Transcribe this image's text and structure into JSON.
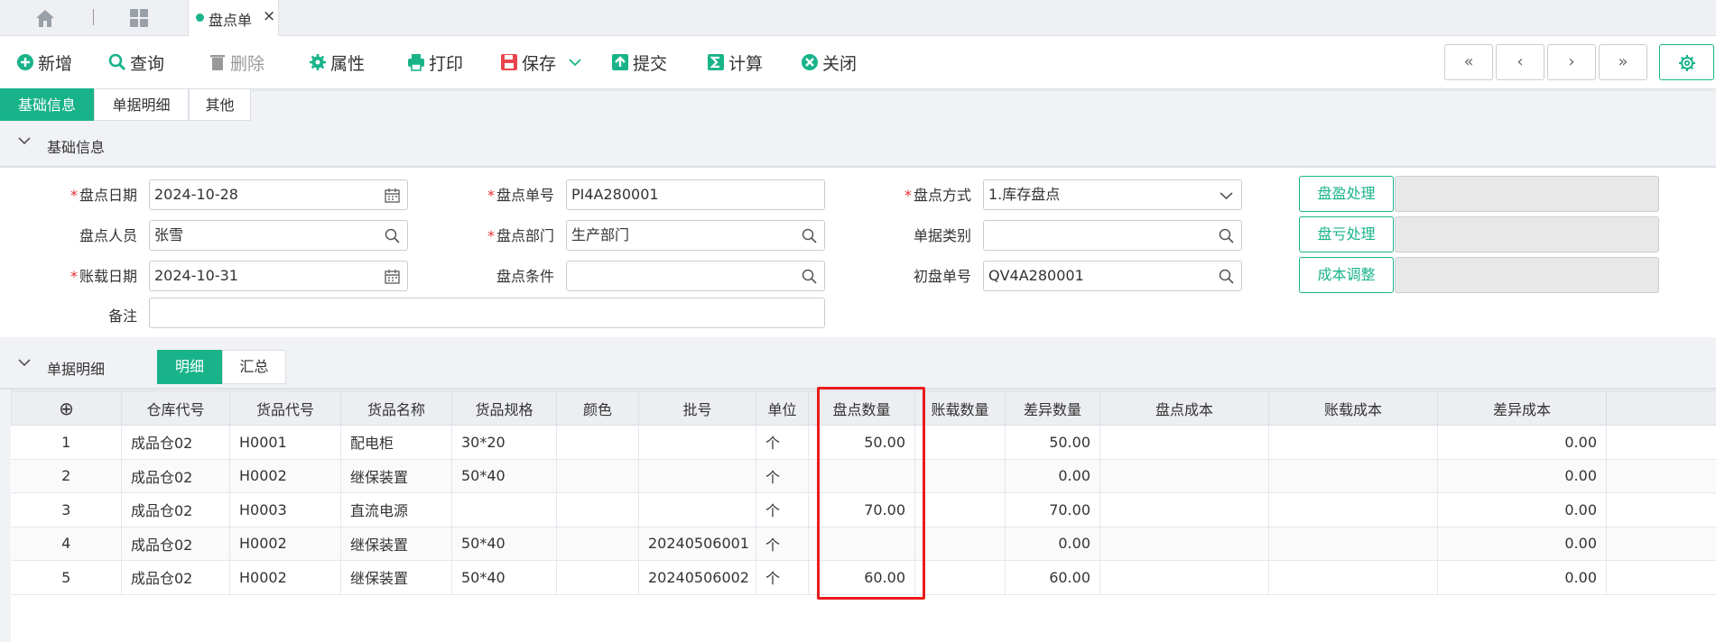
{
  "tabbar": {
    "active_tab": "盘点单",
    "close_glyph": "×"
  },
  "toolbar": {
    "add": "新增",
    "query": "查询",
    "delete": "删除",
    "properties": "属性",
    "print": "打印",
    "save": "保存",
    "submit": "提交",
    "calculate": "计算",
    "close": "关闭",
    "nav_first": "«",
    "nav_prev": "‹",
    "nav_next": "›",
    "nav_last": "»"
  },
  "subtabs": [
    "基础信息",
    "单据明细",
    "其他"
  ],
  "basic_section": {
    "title": "基础信息"
  },
  "form": {
    "date_label": "盘点日期",
    "date_value": "2024-10-28",
    "no_label": "盘点单号",
    "no_value": "PI4A280001",
    "method_label": "盘点方式",
    "method_value": "1.库存盘点",
    "person_label": "盘点人员",
    "person_value": "张雪",
    "dept_label": "盘点部门",
    "dept_value": "生产部门",
    "doctype_label": "单据类别",
    "doctype_value": "",
    "acct_label": "账载日期",
    "acct_value": "2024-10-31",
    "cond_label": "盘点条件",
    "cond_value": "",
    "initial_label": "初盘单号",
    "initial_value": "QV4A280001",
    "remark_label": "备注",
    "remark_value": "",
    "btn_profit": "盘盈处理",
    "btn_loss": "盘亏处理",
    "btn_cost": "成本调整"
  },
  "detail_section": {
    "title": "单据明细",
    "tab_detail": "明细",
    "tab_summary": "汇总"
  },
  "table": {
    "add_glyph": "⊕",
    "headers": [
      "仓库代号",
      "货品代号",
      "货品名称",
      "货品规格",
      "颜色",
      "批号",
      "单位",
      "盘点数量",
      "账载数量",
      "差异数量",
      "盘点成本",
      "账载成本",
      "差异成本"
    ],
    "rows": [
      [
        "1",
        "成品仓02",
        "H0001",
        "配电柜",
        "30*20",
        "",
        "",
        "个",
        "50.00",
        "",
        "50.00",
        "",
        "",
        "0.00"
      ],
      [
        "2",
        "成品仓02",
        "H0002",
        "继保装置",
        "50*40",
        "",
        "",
        "个",
        "",
        "",
        "0.00",
        "",
        "",
        "0.00"
      ],
      [
        "3",
        "成品仓02",
        "H0003",
        "直流电源",
        "",
        "",
        "",
        "个",
        "70.00",
        "",
        "70.00",
        "",
        "",
        "0.00"
      ],
      [
        "4",
        "成品仓02",
        "H0002",
        "继保装置",
        "50*40",
        "",
        "20240506001",
        "个",
        "",
        "",
        "0.00",
        "",
        "",
        "0.00"
      ],
      [
        "5",
        "成品仓02",
        "H0002",
        "继保装置",
        "50*40",
        "",
        "20240506002",
        "个",
        "60.00",
        "",
        "60.00",
        "",
        "",
        "0.00"
      ]
    ]
  },
  "colors": {
    "accent": "#19b38a",
    "highlight_box": "#e81c1c",
    "required": "#e03131"
  }
}
